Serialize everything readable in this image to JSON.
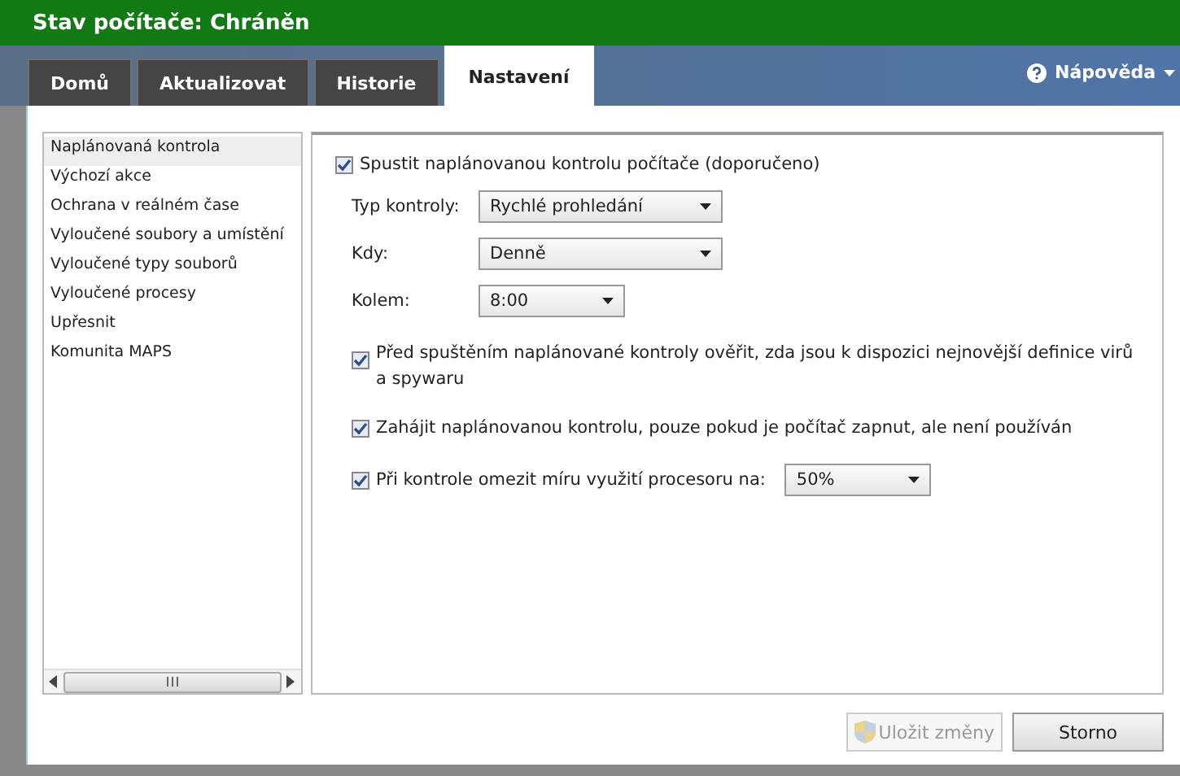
{
  "window": {
    "title": "Stav počítače: Chráněn"
  },
  "tabs": [
    {
      "label": "Domů",
      "selected": false
    },
    {
      "label": "Aktualizovat",
      "selected": false
    },
    {
      "label": "Historie",
      "selected": false
    },
    {
      "label": "Nastavení",
      "selected": true
    }
  ],
  "help": {
    "label": "Nápověda"
  },
  "sidebar": {
    "items": [
      {
        "label": "Naplánovaná kontrola",
        "selected": true
      },
      {
        "label": "Výchozí akce",
        "selected": false
      },
      {
        "label": "Ochrana v reálném čase",
        "selected": false
      },
      {
        "label": "Vyloučené soubory a umístění",
        "selected": false
      },
      {
        "label": "Vyloučené typy souborů",
        "selected": false
      },
      {
        "label": "Vyloučené procesy",
        "selected": false
      },
      {
        "label": "Upřesnit",
        "selected": false
      },
      {
        "label": "Komunita MAPS",
        "selected": false
      }
    ]
  },
  "settings": {
    "main": {
      "label": "Spustit naplánovanou kontrolu počítače (doporučeno)",
      "checked": true
    },
    "fields": [
      {
        "label": "Typ kontroly:",
        "value": "Rychlé prohledání"
      },
      {
        "label": "Kdy:",
        "value": "Denně"
      },
      {
        "label": "Kolem:",
        "value": "8:00"
      }
    ],
    "options": [
      {
        "label": "Před spuštěním naplánované kontroly ověřit, zda jsou k dispozici nejnovější definice virů a spywaru",
        "checked": true
      },
      {
        "label": "Zahájit naplánovanou kontrolu, pouze pokud je počítač zapnut, ale není používán",
        "checked": true
      },
      {
        "label": "Při kontrole omezit míru využití procesoru na:",
        "checked": true,
        "value": "50%"
      }
    ]
  },
  "buttons": [
    {
      "label": "Uložit změny",
      "disabled": true
    },
    {
      "label": "Storno",
      "disabled": false
    }
  ]
}
